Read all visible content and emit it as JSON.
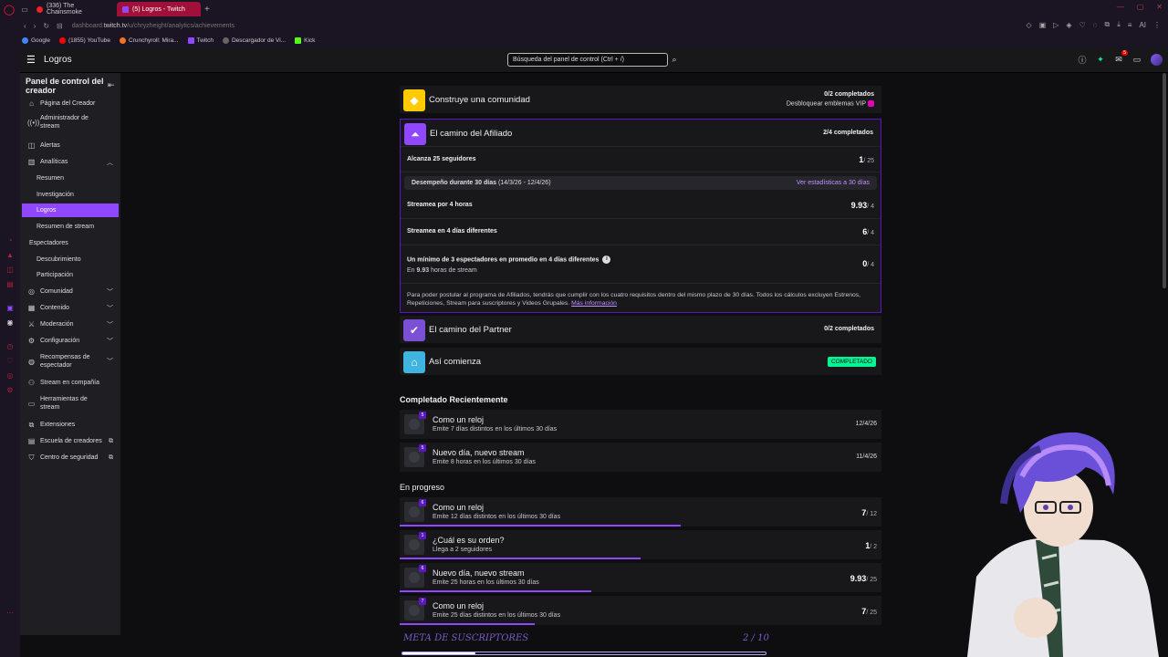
{
  "browser": {
    "tabs": [
      {
        "label": "(336) The Chainsmoke",
        "active": false
      },
      {
        "label": "(5) Logros - Twitch",
        "active": true
      }
    ],
    "new_tab": "+",
    "url_prefix": "dashboard.",
    "url_domain": "twitch.tv",
    "url_path": "/u/chryzheight/analytics/achievements",
    "ai_label": "AI",
    "bookmarks": [
      {
        "label": "Google",
        "color": "#4285f4"
      },
      {
        "label": "(1855) YouTube",
        "color": "#ff0000"
      },
      {
        "label": "Crunchyroll: Mira...",
        "color": "#f47521"
      },
      {
        "label": "Twitch",
        "color": "#9147ff"
      },
      {
        "label": "Descargador de Vi...",
        "color": "#666666"
      },
      {
        "label": "Kick",
        "color": "#53fc18"
      }
    ]
  },
  "header": {
    "title": "Logros",
    "search_placeholder": "Búsqueda del panel de control (Ctrl + /)",
    "notif_count": "5"
  },
  "sidebar": {
    "heading": "Panel de control del creador",
    "items": {
      "pagina": "Página del Creador",
      "admin": "Administrador de stream",
      "alertas": "Alertas",
      "analiticas": "Analíticas",
      "resumen": "Resumen",
      "investigacion": "Investigación",
      "logros": "Logros",
      "resumen_stream": "Resumen de stream",
      "espectadores": "Espectadores",
      "descubrimiento": "Descubrimiento",
      "participacion": "Participación",
      "comunidad": "Comunidad",
      "contenido": "Contenido",
      "moderacion": "Moderación",
      "configuracion": "Configuración",
      "recompensas": "Recompensas de espectador",
      "stream_compania": "Stream en compañía",
      "herramientas": "Herramientas de stream",
      "extensiones": "Extensiones",
      "escuela": "Escuela de creadores",
      "seguridad": "Centro de seguridad"
    }
  },
  "community": {
    "title": "Construye una comunidad",
    "progress": "0/2 completados",
    "unlock": "Desbloquear emblemas VIP"
  },
  "affiliate": {
    "title": "El camino del Afiliado",
    "progress": "2/4 completados",
    "followers_label": "Alcanza 25 seguidores",
    "followers_val": "1",
    "followers_goal": "/ 25",
    "perf_label": "Desempeño durante 30 días",
    "perf_range": "(14/3/26 - 12/4/26)",
    "perf_link": "Ver estadísticas a 30 días",
    "hours_label": "Streamea por 4 horas",
    "hours_val": "9.93",
    "hours_goal": "/ 4",
    "days_label": "Streamea en 4 días diferentes",
    "days_val": "6",
    "days_goal": "/ 4",
    "viewers_label": "Un mínimo de 3 espectadores en promedio en 4 días diferentes",
    "viewers_sub_pre": "En",
    "viewers_sub_val": "9.93",
    "viewers_sub_post": "horas de stream",
    "viewers_val": "0",
    "viewers_goal": "/ 4",
    "footnote": "Para poder postular al programa de Afiliados, tendrás que cumplir con los cuatro requisitos dentro del mismo plazo de 30 días. Todos los cálculos excluyen Estrenos, Repeticiones, Stream para suscriptores y Videos Grupales.",
    "footnote_link": "Más información"
  },
  "partner": {
    "title": "El camino del Partner",
    "progress": "0/2 completados"
  },
  "start": {
    "title": "Así comienza",
    "badge": "COMPLETADO"
  },
  "recent": {
    "heading": "Completado Recientemente",
    "items": [
      {
        "level": "5",
        "title": "Como un reloj",
        "sub": "Emite 7 días distintos en los últimos 30 días",
        "date": "12/4/26"
      },
      {
        "level": "5",
        "title": "Nuevo día, nuevo stream",
        "sub": "Emite 8 horas en los últimos 30 días",
        "date": "11/4/26"
      }
    ]
  },
  "progress": {
    "heading": "En progreso",
    "items": [
      {
        "level": "6",
        "title": "Como un reloj",
        "sub": "Emite 12 días distintos en los últimos 30 días",
        "val": "7",
        "goal": "/ 12",
        "fraction": 0.583
      },
      {
        "level": "1",
        "title": "¿Cuál es su orden?",
        "sub": "Llega a 2 seguidores",
        "val": "1",
        "goal": "/ 2",
        "fraction": 0.5
      },
      {
        "level": "6",
        "title": "Nuevo día, nuevo stream",
        "sub": "Emite 25 horas en los últimos 30 días",
        "val": "9.93",
        "goal": "/ 25",
        "fraction": 0.397
      },
      {
        "level": "7",
        "title": "Como un reloj",
        "sub": "Emite 25 días distintos en los últimos 30 días",
        "val": "7",
        "goal": "/ 25",
        "fraction": 0.28
      }
    ]
  },
  "overlay": {
    "sub_goal_label": "META DE SUSCRIPTORES",
    "sub_goal_value": "2 / 10",
    "sub_goal_fraction": 0.2
  },
  "colors": {
    "twitch_purple": "#9147ff",
    "completed_green": "#00f593",
    "community_yellow": "#ffca00",
    "start_teal": "#40b4e0"
  }
}
